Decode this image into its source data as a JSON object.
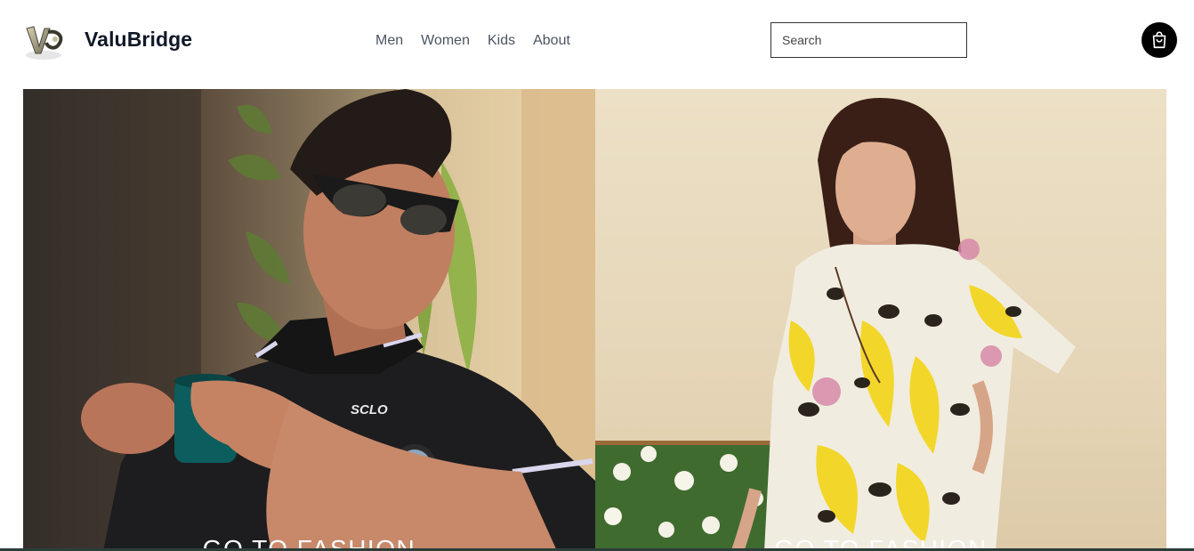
{
  "brand": {
    "name": "ValuBridge",
    "logo_icon": "vb-logo-icon"
  },
  "nav": {
    "items": [
      {
        "label": "Men"
      },
      {
        "label": "Women"
      },
      {
        "label": "Kids"
      },
      {
        "label": "About"
      }
    ]
  },
  "search": {
    "placeholder": "Search",
    "value": ""
  },
  "cart": {
    "icon": "shopping-bag-icon",
    "color": "#000000"
  },
  "hero": {
    "men": {
      "cta": "GO TO FASHION",
      "image": "man-in-black-polo-with-sunglasses-and-mug"
    },
    "women": {
      "cta": "GO TO FASHION",
      "image": "woman-in-yellow-leaf-print-tunic"
    }
  }
}
